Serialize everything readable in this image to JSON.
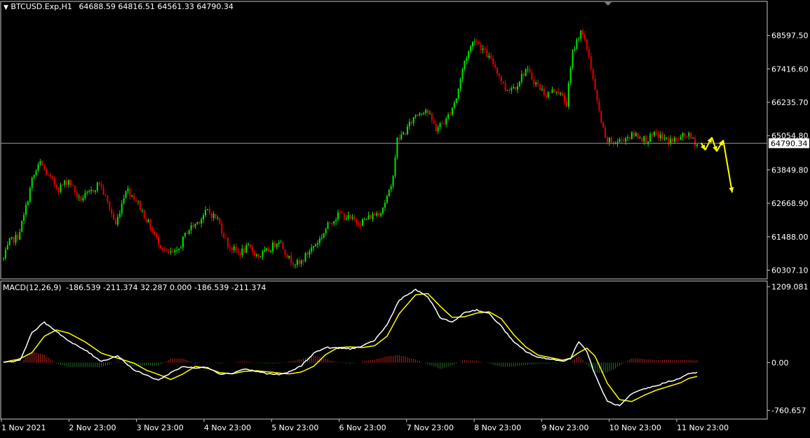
{
  "header": {
    "symbol": "BTCUSD.Exp,H1",
    "ohlc": "64688.59 64816.51 64561.33 64790.34"
  },
  "macd_header": {
    "label": "MACD(12,26,9)",
    "values": "-186.539 -211.374 32.287 0.000 -186.539 -211.374"
  },
  "colors": {
    "background": "#000000",
    "bull_candle": "#00e600",
    "bear_candle": "#e00000",
    "macd_line": "#ffffff",
    "signal_line": "#ffff00",
    "hist_pos": "#c02020",
    "hist_neg": "#207020",
    "arrow": "#ffff00",
    "price_line": "#8f98a0",
    "frame": "#c8c8c8"
  },
  "chart_data": [
    {
      "type": "candlestick",
      "title": "BTCUSD.Exp,H1",
      "current_price": "64790.34",
      "y_ticks": [
        "68597.50",
        "67416.60",
        "66235.70",
        "65054.80",
        "63849.80",
        "62668.90",
        "61488.00",
        "60307.10"
      ],
      "ylim": [
        59998,
        69800
      ],
      "x_ticks": [
        "1 Nov 2021",
        "2 Nov 23:00",
        "3 Nov 23:00",
        "4 Nov 23:00",
        "5 Nov 23:00",
        "6 Nov 23:00",
        "7 Nov 23:00",
        "8 Nov 23:00",
        "9 Nov 23:00",
        "10 Nov 23:00",
        "11 Nov 23:00"
      ],
      "anchors": [
        [
          0,
          60700
        ],
        [
          3,
          61300
        ],
        [
          7,
          61500
        ],
        [
          10,
          62200
        ],
        [
          14,
          63500
        ],
        [
          18,
          64100
        ],
        [
          22,
          63600
        ],
        [
          27,
          63200
        ],
        [
          32,
          63500
        ],
        [
          37,
          62800
        ],
        [
          42,
          63000
        ],
        [
          47,
          63400
        ],
        [
          52,
          62500
        ],
        [
          55,
          61900
        ],
        [
          60,
          63200
        ],
        [
          65,
          62800
        ],
        [
          70,
          62100
        ],
        [
          75,
          61400
        ],
        [
          80,
          60900
        ],
        [
          85,
          60900
        ],
        [
          90,
          61700
        ],
        [
          95,
          62000
        ],
        [
          100,
          62400
        ],
        [
          105,
          62100
        ],
        [
          110,
          61200
        ],
        [
          115,
          60900
        ],
        [
          120,
          61100
        ],
        [
          125,
          60800
        ],
        [
          130,
          61000
        ],
        [
          135,
          61400
        ],
        [
          140,
          60700
        ],
        [
          145,
          60500
        ],
        [
          150,
          61000
        ],
        [
          155,
          61400
        ],
        [
          160,
          62000
        ],
        [
          165,
          62300
        ],
        [
          170,
          62100
        ],
        [
          175,
          62000
        ],
        [
          180,
          62200
        ],
        [
          185,
          62400
        ],
        [
          190,
          63200
        ],
        [
          193,
          64900
        ],
        [
          197,
          65200
        ],
        [
          202,
          65800
        ],
        [
          207,
          66000
        ],
        [
          212,
          65300
        ],
        [
          217,
          65600
        ],
        [
          222,
          66400
        ],
        [
          226,
          67700
        ],
        [
          231,
          68500
        ],
        [
          236,
          68000
        ],
        [
          241,
          67500
        ],
        [
          246,
          66700
        ],
        [
          251,
          66800
        ],
        [
          256,
          67400
        ],
        [
          261,
          66900
        ],
        [
          266,
          66500
        ],
        [
          271,
          66700
        ],
        [
          276,
          66200
        ],
        [
          279,
          68000
        ],
        [
          283,
          68800
        ],
        [
          287,
          67900
        ],
        [
          291,
          66200
        ],
        [
          295,
          64900
        ],
        [
          300,
          64800
        ],
        [
          305,
          65000
        ],
        [
          310,
          65100
        ],
        [
          315,
          64900
        ],
        [
          320,
          65100
        ],
        [
          325,
          64900
        ],
        [
          330,
          64900
        ],
        [
          335,
          65100
        ],
        [
          340,
          64750
        ]
      ],
      "projection_arrow": [
        [
          "+0.0",
          64800
        ],
        [
          "+1.0",
          64550
        ],
        [
          "+2.6",
          65000
        ],
        [
          "+3.8",
          64500
        ],
        [
          "+5.4",
          64900
        ],
        [
          "+7.6",
          63050
        ]
      ]
    },
    {
      "type": "macd",
      "title": "MACD(12,26,9)",
      "y_ticks": [
        "1209.081",
        "0.00",
        "-760.657"
      ],
      "ylim": [
        -900,
        1300
      ],
      "macd_anchors": [
        [
          0,
          10
        ],
        [
          8,
          30
        ],
        [
          14,
          480
        ],
        [
          20,
          640
        ],
        [
          26,
          500
        ],
        [
          32,
          340
        ],
        [
          40,
          200
        ],
        [
          48,
          20
        ],
        [
          56,
          110
        ],
        [
          64,
          -120
        ],
        [
          70,
          -200
        ],
        [
          76,
          -280
        ],
        [
          82,
          -160
        ],
        [
          88,
          -60
        ],
        [
          94,
          -90
        ],
        [
          100,
          -70
        ],
        [
          106,
          -180
        ],
        [
          112,
          -170
        ],
        [
          118,
          -100
        ],
        [
          124,
          -140
        ],
        [
          130,
          -180
        ],
        [
          136,
          -190
        ],
        [
          140,
          -150
        ],
        [
          146,
          -50
        ],
        [
          152,
          150
        ],
        [
          158,
          240
        ],
        [
          164,
          230
        ],
        [
          170,
          220
        ],
        [
          176,
          260
        ],
        [
          182,
          360
        ],
        [
          188,
          600
        ],
        [
          194,
          1000
        ],
        [
          202,
          1160
        ],
        [
          208,
          1050
        ],
        [
          214,
          720
        ],
        [
          220,
          640
        ],
        [
          226,
          800
        ],
        [
          232,
          840
        ],
        [
          238,
          780
        ],
        [
          244,
          580
        ],
        [
          250,
          330
        ],
        [
          256,
          180
        ],
        [
          262,
          80
        ],
        [
          268,
          60
        ],
        [
          274,
          20
        ],
        [
          278,
          70
        ],
        [
          282,
          340
        ],
        [
          286,
          180
        ],
        [
          290,
          -200
        ],
        [
          296,
          -620
        ],
        [
          302,
          -690
        ],
        [
          308,
          -500
        ],
        [
          314,
          -420
        ],
        [
          320,
          -370
        ],
        [
          326,
          -300
        ],
        [
          332,
          -250
        ],
        [
          336,
          -170
        ],
        [
          340,
          -160
        ]
      ],
      "signal_anchors": [
        [
          0,
          5
        ],
        [
          8,
          60
        ],
        [
          14,
          160
        ],
        [
          20,
          420
        ],
        [
          26,
          520
        ],
        [
          32,
          470
        ],
        [
          40,
          330
        ],
        [
          48,
          150
        ],
        [
          56,
          70
        ],
        [
          64,
          -10
        ],
        [
          70,
          -120
        ],
        [
          76,
          -190
        ],
        [
          82,
          -270
        ],
        [
          88,
          -180
        ],
        [
          94,
          -60
        ],
        [
          100,
          -90
        ],
        [
          106,
          -160
        ],
        [
          112,
          -180
        ],
        [
          118,
          -140
        ],
        [
          124,
          -130
        ],
        [
          130,
          -150
        ],
        [
          136,
          -170
        ],
        [
          140,
          -180
        ],
        [
          146,
          -150
        ],
        [
          152,
          -60
        ],
        [
          158,
          130
        ],
        [
          164,
          240
        ],
        [
          170,
          250
        ],
        [
          176,
          240
        ],
        [
          182,
          270
        ],
        [
          188,
          420
        ],
        [
          194,
          780
        ],
        [
          202,
          1080
        ],
        [
          208,
          1100
        ],
        [
          214,
          900
        ],
        [
          220,
          720
        ],
        [
          226,
          730
        ],
        [
          232,
          790
        ],
        [
          238,
          810
        ],
        [
          244,
          700
        ],
        [
          250,
          450
        ],
        [
          256,
          250
        ],
        [
          262,
          120
        ],
        [
          268,
          80
        ],
        [
          274,
          40
        ],
        [
          278,
          70
        ],
        [
          282,
          160
        ],
        [
          286,
          230
        ],
        [
          290,
          100
        ],
        [
          296,
          -330
        ],
        [
          302,
          -590
        ],
        [
          308,
          -620
        ],
        [
          314,
          -520
        ],
        [
          320,
          -440
        ],
        [
          326,
          -380
        ],
        [
          332,
          -320
        ],
        [
          336,
          -250
        ],
        [
          340,
          -220
        ]
      ]
    }
  ]
}
